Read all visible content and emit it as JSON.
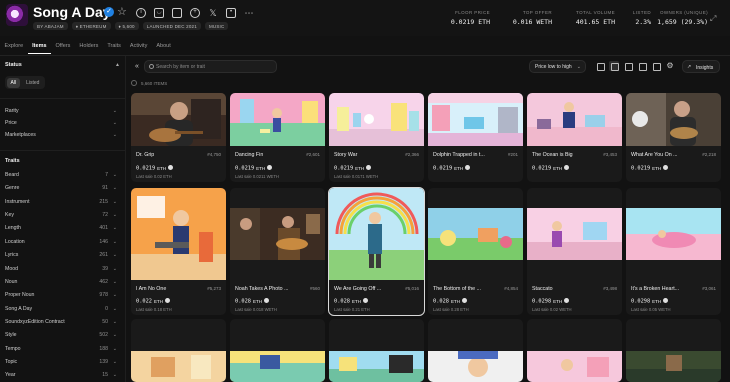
{
  "collection": {
    "name": "Song A Day",
    "verified_mark": "✓",
    "meta": [
      "BY ABAJAM",
      "♦ ETHEREUM",
      "♦ 5,600",
      "LAUNCHED DEC 2021",
      "MUSIC"
    ],
    "social_icons": [
      "info-icon",
      "discord-icon",
      "copy-icon",
      "globe-icon",
      "x-icon",
      "instagram-icon",
      "more-icon"
    ]
  },
  "stats": [
    {
      "label": "FLOOR PRICE",
      "value": "0.0219 ETH"
    },
    {
      "label": "TOP OFFER",
      "value": "0.016 WETH"
    },
    {
      "label": "TOTAL VOLUME",
      "value": "401.65 ETH"
    },
    {
      "label": "LISTED",
      "value": "2.3%"
    },
    {
      "label": "OWNERS (UNIQUE)",
      "value": "1,659 (29.3%)"
    }
  ],
  "tabs": [
    "Explore",
    "Items",
    "Offers",
    "Holders",
    "Traits",
    "Activity",
    "About"
  ],
  "active_tab": "Items",
  "sidebar": {
    "status_title": "Status",
    "status_options": [
      "All",
      "Listed"
    ],
    "filters": [
      "Rarity",
      "Price",
      "Marketplaces"
    ],
    "traits_title": "Traits",
    "traits": [
      {
        "name": "Beard",
        "count": "7"
      },
      {
        "name": "Genre",
        "count": "91"
      },
      {
        "name": "Instrument",
        "count": "215"
      },
      {
        "name": "Key",
        "count": "72"
      },
      {
        "name": "Length",
        "count": "401"
      },
      {
        "name": "Location",
        "count": "146"
      },
      {
        "name": "Lyrics",
        "count": "261"
      },
      {
        "name": "Mood",
        "count": "39"
      },
      {
        "name": "Noun",
        "count": "462"
      },
      {
        "name": "Proper Noun",
        "count": "978"
      },
      {
        "name": "Song A Day",
        "count": "0"
      },
      {
        "name": "SoundxyzEdition Contract",
        "count": "50"
      },
      {
        "name": "Style",
        "count": "502"
      },
      {
        "name": "Tempo",
        "count": "188"
      },
      {
        "name": "Topic",
        "count": "139"
      },
      {
        "name": "Year",
        "count": "15"
      }
    ]
  },
  "toolbar": {
    "search_placeholder": "Search by item or trait",
    "sort_label": "Price low to high",
    "insights_label": "Insights",
    "item_count": "5,660 ITEMS"
  },
  "cards": [
    {
      "name": "Dr. Grip",
      "token": "#4,750",
      "price": "0.0219",
      "unit": "ETH",
      "last": "Last sale 0.02 ETH"
    },
    {
      "name": "Dancing Fin",
      "token": "#2,601",
      "price": "0.0219",
      "unit": "ETH",
      "last": "Last sale 0.0211 WETH"
    },
    {
      "name": "Story War",
      "token": "#2,366",
      "price": "0.0219",
      "unit": "ETH",
      "last": "Last sale 0.0171 WETH"
    },
    {
      "name": "Dolphin Trapped in t...",
      "token": "#201",
      "price": "0.0219",
      "unit": "ETH",
      "last": ""
    },
    {
      "name": "The Ocean is Big",
      "token": "#3,453",
      "price": "0.0219",
      "unit": "ETH",
      "last": ""
    },
    {
      "name": "What Are You On ...",
      "token": "#2,218",
      "price": "0.0219",
      "unit": "ETH",
      "last": ""
    },
    {
      "name": "I Am No One",
      "token": "#5,273",
      "price": "0.022",
      "unit": "ETH",
      "last": "Last sale 0.18 ETH"
    },
    {
      "name": "Noah Takes A Photo ...",
      "token": "#560",
      "price": "0.028",
      "unit": "ETH",
      "last": "Last sale 0.018 WETH"
    },
    {
      "name": "We Are Going Off ...",
      "token": "#5,016",
      "price": "0.028",
      "unit": "ETH",
      "last": "Last sale 0.21 ETH"
    },
    {
      "name": "The Bottom of the ...",
      "token": "#4,854",
      "price": "0.028",
      "unit": "ETH",
      "last": "Last sale 0.28 ETH"
    },
    {
      "name": "Staccato",
      "token": "#3,498",
      "price": "0.0298",
      "unit": "ETH",
      "last": "Last sale 0.02 WETH"
    },
    {
      "name": "It's a Broken Heart...",
      "token": "#3,061",
      "price": "0.0298",
      "unit": "ETH",
      "last": "Last sale 0.05 WETH"
    }
  ]
}
